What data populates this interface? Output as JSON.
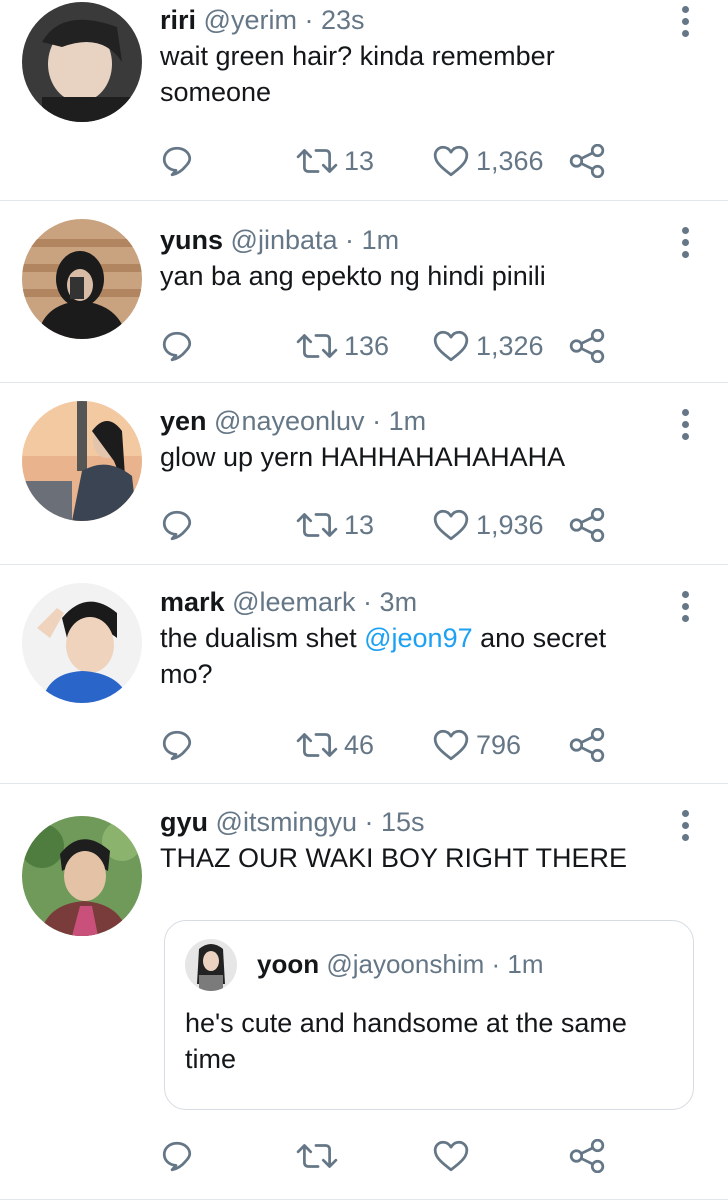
{
  "tweets": [
    {
      "name": "riri",
      "handle": "@yerim",
      "time": "23s",
      "text": "wait green hair? kinda remember someone",
      "retweets": "13",
      "likes": "1,366"
    },
    {
      "name": "yuns",
      "handle": "@jinbata",
      "time": "1m",
      "text": "yan ba ang epekto ng hindi pinili",
      "retweets": "136",
      "likes": "1,326"
    },
    {
      "name": "yen",
      "handle": "@nayeonluv",
      "time": "1m",
      "text": "glow up yern HAHHAHAHAHAHA",
      "retweets": "13",
      "likes": "1,936"
    },
    {
      "name": "mark",
      "handle": "@leemark",
      "time": "3m",
      "text_before": "the dualism shet ",
      "mention": "@jeon97",
      "text_after": " ano secret mo?",
      "retweets": "46",
      "likes": "796"
    },
    {
      "name": "gyu",
      "handle": "@itsmingyu",
      "time": "15s",
      "text": "THAZ OUR WAKI BOY RIGHT THERE",
      "quote": {
        "name": "yoon",
        "handle": "@jayoonshim",
        "time": "1m",
        "text": "he's cute and handsome at the same time"
      }
    }
  ],
  "separator": "·",
  "icons": [
    "reply-icon",
    "retweet-icon",
    "like-icon",
    "share-icon",
    "more-vertical-icon"
  ],
  "colors": {
    "mention": "#1da1f2",
    "muted": "#657786",
    "divider": "#e1e6ea"
  }
}
